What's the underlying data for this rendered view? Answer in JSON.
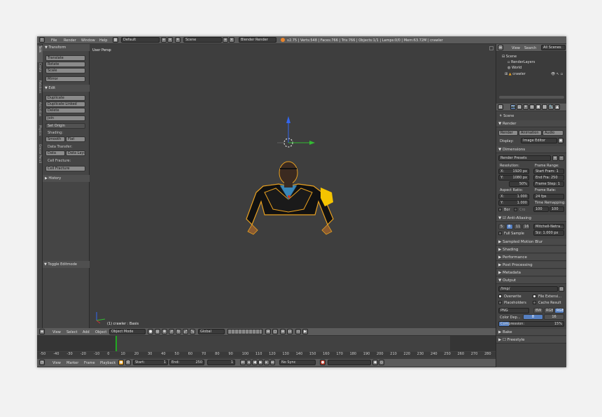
{
  "topbar": {
    "menus": [
      "File",
      "Render",
      "Window",
      "Help"
    ],
    "layout": "Default",
    "scene": "Scene",
    "engine": "Blender Render",
    "stats": "v2.75 | Verts:548 | Faces:766 | Tris:766 | Objects:1/1 | Lamps:0/0 | Mem:63.72M | crawler"
  },
  "tabs": [
    "Tools",
    "Create",
    "Relations",
    "Animation",
    "Physics",
    "Grease Pencil"
  ],
  "toolshelf": {
    "transform_header": "▼ Transform",
    "transform": [
      "Translate",
      "Rotate",
      "Scale"
    ],
    "mirror": "Mirror",
    "edit_header": "▼ Edit",
    "edit": [
      "Duplicate",
      "Duplicate Linked",
      "Delete"
    ],
    "join": "Join",
    "set_origin": "Set Origin",
    "shading_label": "Shading:",
    "shading": [
      "Smooth",
      "Flat"
    ],
    "data_transfer_label": "Data Transfer:",
    "data_transfer": [
      "Data",
      "Data Layo"
    ],
    "cell_fracture_label": "Cell Fracture:",
    "cell_fracture": "Cell Fracture",
    "history": "▶ History",
    "toggle_editmode": "▼ Toggle Editmode"
  },
  "viewport": {
    "label": "User Persp",
    "object_label": "(1) crawler : Basis"
  },
  "view_header": {
    "menus": [
      "View",
      "Select",
      "Add",
      "Object"
    ],
    "mode": "Object Mode",
    "orientation": "Global"
  },
  "timeline": {
    "ticks": [
      "-50",
      "-40",
      "-30",
      "-20",
      "-10",
      "0",
      "10",
      "20",
      "30",
      "40",
      "50",
      "60",
      "70",
      "80",
      "90",
      "100",
      "110",
      "120",
      "130",
      "140",
      "150",
      "160",
      "170",
      "180",
      "190",
      "200",
      "210",
      "220",
      "230",
      "240",
      "250",
      "260",
      "270",
      "280"
    ],
    "menus": [
      "View",
      "Marker",
      "Frame",
      "Playback"
    ],
    "start": "Start:",
    "start_value": "1",
    "end": "End:",
    "end_value": "250",
    "current": "1",
    "sync": "No Sync"
  },
  "outliner": {
    "menus": [
      "View",
      "Search"
    ],
    "filter": "All Scenes",
    "items": [
      "Scene",
      "RenderLayers",
      "World",
      "crawler"
    ]
  },
  "properties": {
    "context": "Scene",
    "render_header": "▼ Render",
    "render_buttons": [
      "Render",
      "Animation",
      "Audio"
    ],
    "display_label": "Display:",
    "display_value": "Image Editor",
    "dimensions_header": "▼ Dimensions",
    "render_presets": "Render Presets",
    "resolution": "Resolution:",
    "res_x": "X:",
    "res_x_value": "1920 px",
    "res_y": "Y:",
    "res_y_value": "1080 px",
    "res_pct": "50%",
    "frame_range": "Frame Range:",
    "start_frame": "Start Fram: 1",
    "end_frame": "End Fra: 250",
    "frame_step": "Frame Step: 1",
    "aspect_ratio": "Aspect Ratio:",
    "aspect_x": "X:",
    "aspect_x_value": "1.000",
    "aspect_y": "Y:",
    "aspect_y_value": "1.000",
    "frame_rate": "Frame Rate:",
    "fps": "24 fps",
    "time_remapping": "Time Remapping:",
    "remap_old": "100",
    "remap_new": "100",
    "border": "Bor",
    "crop": "Cro",
    "aa_header": "Anti-Aliasing",
    "aa_samples": [
      "5",
      "8",
      "11",
      "16"
    ],
    "aa_filter": "Mitchell-Netra...",
    "full_sample": "Full Sample",
    "aa_size": "Siz: 1.000 px",
    "collapsed": [
      "▶ Sampled Motion Blur",
      "▶ Shading",
      "▶ Performance",
      "▶ Post Processing",
      "▶ Metadata"
    ],
    "output_header": "▼ Output",
    "output_path": "/tmp/",
    "overwrite": "Overwrite",
    "file_ext": "File Extensi...",
    "placeholders": "Placeholders",
    "cache_result": "Cache Result",
    "format": "PNG",
    "color_modes": [
      "BW",
      "RGB",
      "RGBA"
    ],
    "color_depth_label": "Color Dep...",
    "color_depth": [
      "8",
      "16"
    ],
    "compression": "Compression:",
    "compression_value": "15%",
    "bake": "▶ Bake",
    "freestyle": "Freestyle"
  },
  "colors": {
    "accent": "#5680c2",
    "frame_line": "#22aa22",
    "axis_x": "#cc3333",
    "axis_y": "#33bb33",
    "axis_z": "#3366ee"
  }
}
